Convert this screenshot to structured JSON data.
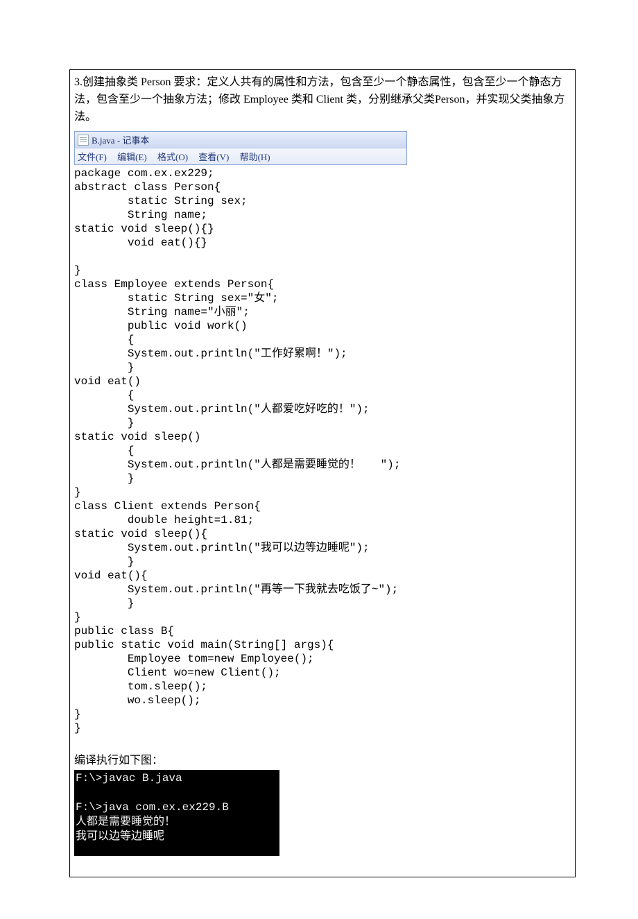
{
  "question": "3.创建抽象类 Person 要求：定义人共有的属性和方法，包含至少一个静态属性，包含至少一个静态方法，包含至少一个抽象方法；修改 Employee 类和 Client 类，分别继承父类Person，并实现父类抽象方法。",
  "notepad": {
    "title": "B.java - 记事本",
    "menu": {
      "file": "文件(F)",
      "edit": "编辑(E)",
      "format": "格式(O)",
      "view": "查看(V)",
      "help": "帮助(H)"
    }
  },
  "code": "package com.ex.ex229;\nabstract class Person{\n        static String sex;\n        String name;\nstatic void sleep(){}\n        void eat(){}\n\n}\nclass Employee extends Person{\n        static String sex=\"女\";\n        String name=\"小丽\";\n        public void work()\n        {\n        System.out.println(\"工作好累啊！\");\n        }\nvoid eat()\n        {\n        System.out.println(\"人都爱吃好吃的！\");\n        }\nstatic void sleep()\n        {\n        System.out.println(\"人都是需要睡觉的！   \");\n        }\n}\nclass Client extends Person{\n        double height=1.81;\nstatic void sleep(){\n        System.out.println(\"我可以边等边睡呢\");\n        }\nvoid eat(){\n        System.out.println(\"再等一下我就去吃饭了~\");\n        }\n}\npublic class B{\npublic static void main(String[] args){\n        Employee tom=new Employee();\n        Client wo=new Client();\n        tom.sleep();\n        wo.sleep();\n}\n}",
  "caption": "编译执行如下图：",
  "terminal": "F:\\>javac B.java\n\nF:\\>java com.ex.ex229.B\n人都是需要睡觉的！\n我可以边等边睡呢"
}
